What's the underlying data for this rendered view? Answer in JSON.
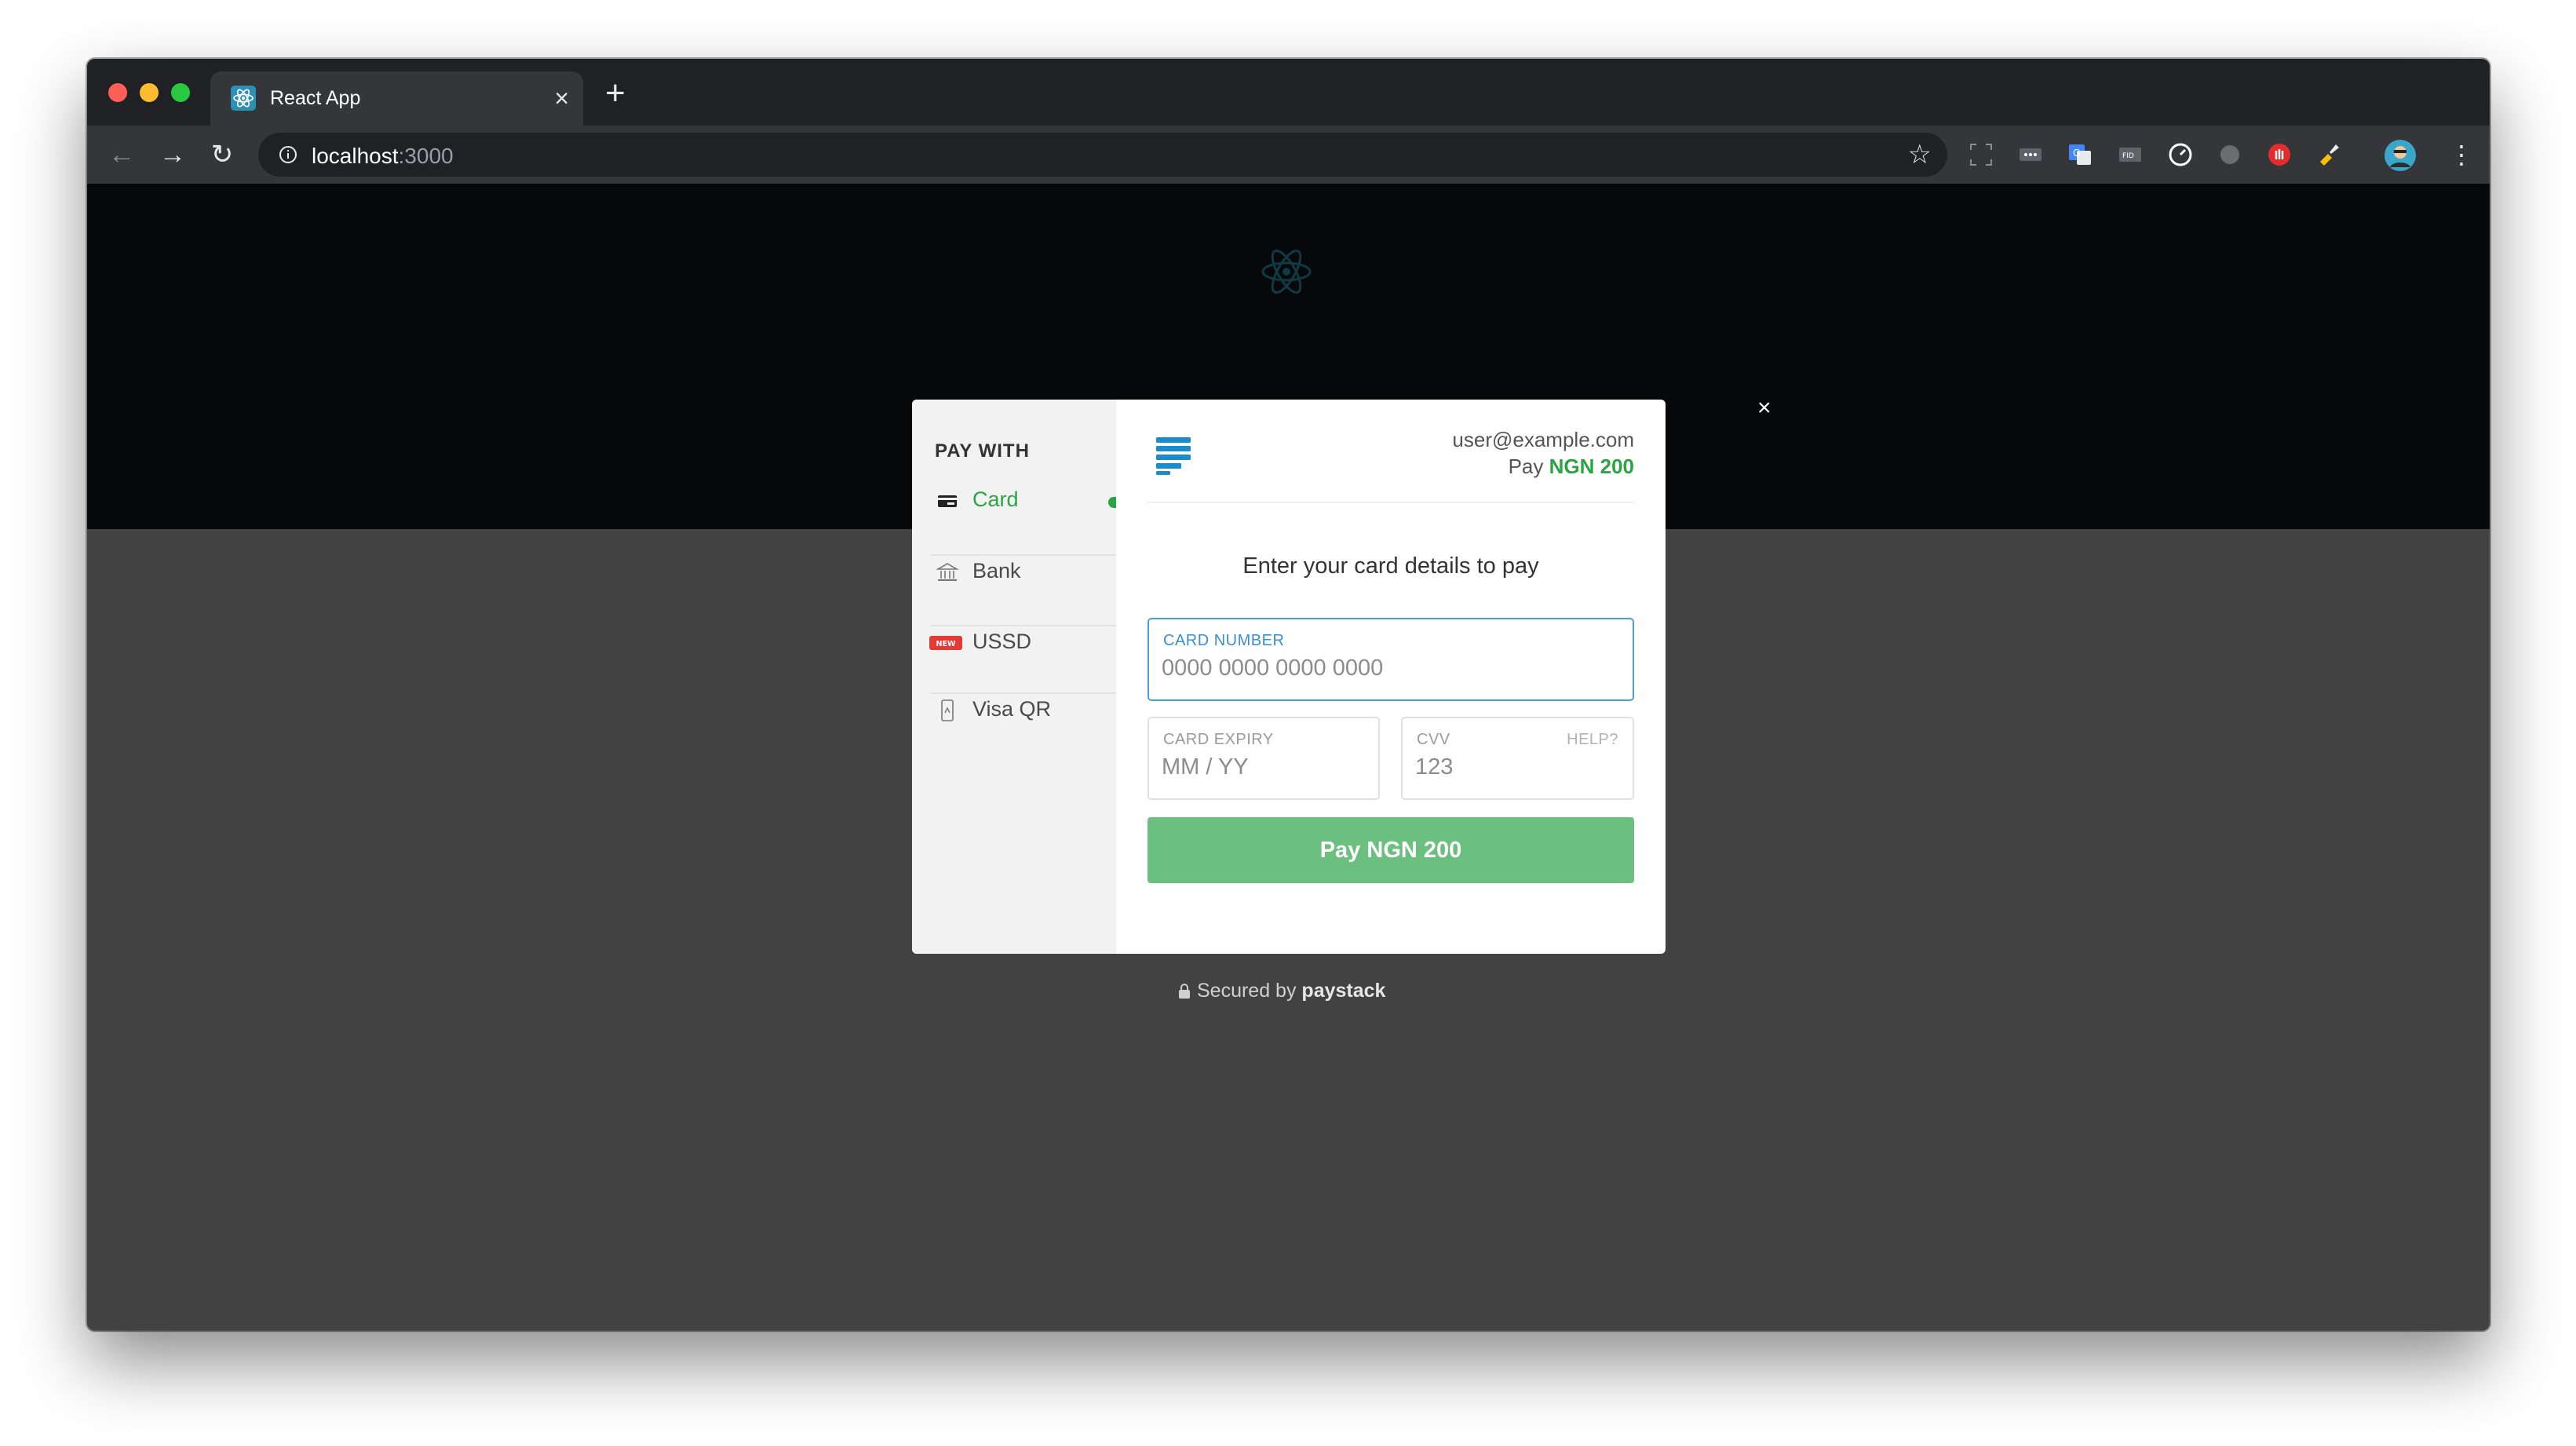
{
  "browser": {
    "tab_title": "React App",
    "tab_close": "×",
    "new_tab": "+",
    "url_host": "localhost",
    "url_port": ":3000",
    "extensions": [
      "screenshot-icon",
      "more-dots-icon",
      "translate-icon",
      "fid-icon",
      "speed-icon",
      "grey-dot-icon",
      "hand-icon",
      "brush-icon"
    ]
  },
  "checkout": {
    "sidebar": {
      "heading": "PAY WITH",
      "items": [
        {
          "label": "Card",
          "icon": "card-icon",
          "active": true
        },
        {
          "label": "Bank",
          "icon": "bank-icon",
          "active": false
        },
        {
          "label": "USSD",
          "icon": "new-badge-icon",
          "badge": "NEW",
          "active": false
        },
        {
          "label": "Visa QR",
          "icon": "phone-qr-icon",
          "active": false
        }
      ]
    },
    "email": "user@example.com",
    "pay_prefix": "Pay",
    "amount": "NGN 200",
    "instruction": "Enter your card details to pay",
    "card_number": {
      "label": "CARD NUMBER",
      "placeholder": "0000 0000 0000 0000",
      "value": ""
    },
    "card_expiry": {
      "label": "CARD EXPIRY",
      "placeholder": "MM / YY",
      "value": ""
    },
    "cvv": {
      "label": "CVV",
      "help": "HELP?",
      "placeholder": "123",
      "value": ""
    },
    "pay_button": "Pay NGN 200",
    "close": "×",
    "secured_prefix": "Secured by",
    "secured_brand": "paystack"
  },
  "colors": {
    "accent": "#29a543",
    "button": "#6cc07f",
    "focus": "#4a9fd8"
  }
}
